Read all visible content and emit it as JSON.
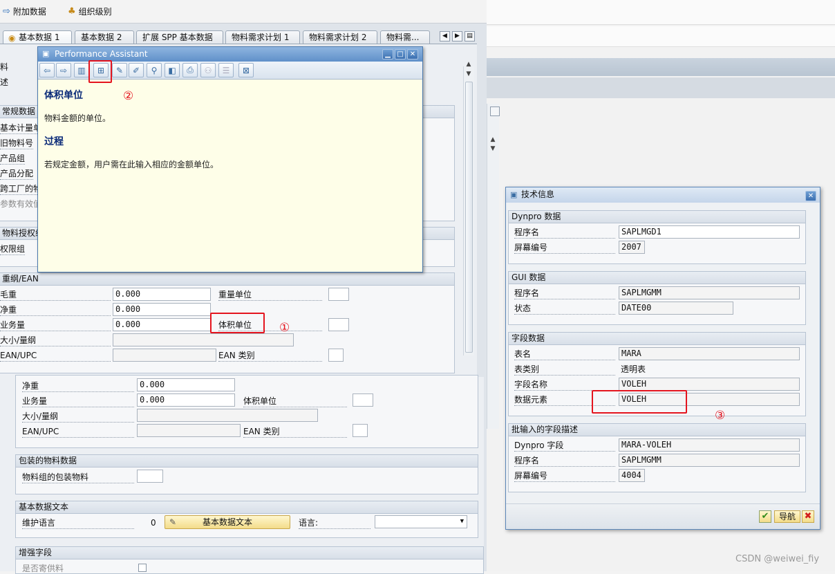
{
  "toolbar": {
    "additional_data": "附加数据",
    "org_levels": "组织级别"
  },
  "tabs": [
    {
      "label": "基本数据 1"
    },
    {
      "label": "基本数据 2"
    },
    {
      "label": "扩展 SPP 基本数据"
    },
    {
      "label": "物料需求计划 1"
    },
    {
      "label": "物料需求计划 2"
    },
    {
      "label": "物料需..."
    }
  ],
  "main": {
    "left_labels": [
      "料",
      "述",
      "常规数据",
      "基本计量单",
      "旧物料号",
      "产品组",
      "产品分配",
      "跨工厂的物",
      "参数有效值",
      "物料授权组",
      "权限组"
    ],
    "dims_section": "重纲/EAN",
    "gross_weight_label": "毛重",
    "gross_weight": "0.000",
    "net_weight_label": "净重",
    "net_weight": "0.000",
    "volume_label": "业务量",
    "volume": "0.000",
    "weight_unit_label": "重量单位",
    "volume_unit_label": "体积单位",
    "size_label": "大小/量纲",
    "ean_label": "EAN/UPC",
    "ean_cat_label": "EAN 类别",
    "lower_net_weight_label": "净重",
    "lower_net_weight": "0.000",
    "lower_volume_label": "业务量",
    "lower_volume": "0.000",
    "lower_volume_unit_label": "体积单位",
    "lower_size_label": "大小/量纲",
    "lower_ean_label": "EAN/UPC",
    "lower_ean_cat_label": "EAN 类别",
    "packaging_section": "包装的物料数据",
    "packaging_label": "物料组的包装物料",
    "text_section": "基本数据文本",
    "maint_lang_label": "维护语言",
    "maint_lang_value": "0",
    "basic_text_button": "基本数据文本",
    "language_label": "语言:",
    "enhanced_section": "增强字段",
    "consignment_label": "是否寄供料"
  },
  "assistant": {
    "title": "Performance Assistant",
    "heading1": "体积单位",
    "text1": "物料金额的单位。",
    "heading2": "过程",
    "text2": "若规定金额，用户需在此输入相应的金额单位。"
  },
  "tech_info": {
    "title": "技术信息",
    "dynpro_section": "Dynpro 数据",
    "program_label": "程序名",
    "program_value": "SAPLMGD1",
    "screen_label": "屏幕编号",
    "screen_value": "2007",
    "gui_section": "GUI 数据",
    "gui_program_label": "程序名",
    "gui_program_value": "SAPLMGMM",
    "status_label": "状态",
    "status_value": "DATE00",
    "field_section": "字段数据",
    "table_label": "表名",
    "table_value": "MARA",
    "table_type_label": "表类别",
    "table_type_value": "透明表",
    "field_name_label": "字段名称",
    "field_name_value": "VOLEH",
    "data_element_label": "数据元素",
    "data_element_value": "VOLEH",
    "batch_section": "批输入的字段描述",
    "dynpro_field_label": "Dynpro 字段",
    "dynpro_field_value": "MARA-VOLEH",
    "batch_program_label": "程序名",
    "batch_program_value": "SAPLMGMM",
    "batch_screen_label": "屏幕编号",
    "batch_screen_value": "4004",
    "nav_button": "导航"
  },
  "annotations": {
    "one": "①",
    "two": "②",
    "three": "③"
  },
  "watermark": "CSDN @weiwei_fiy"
}
